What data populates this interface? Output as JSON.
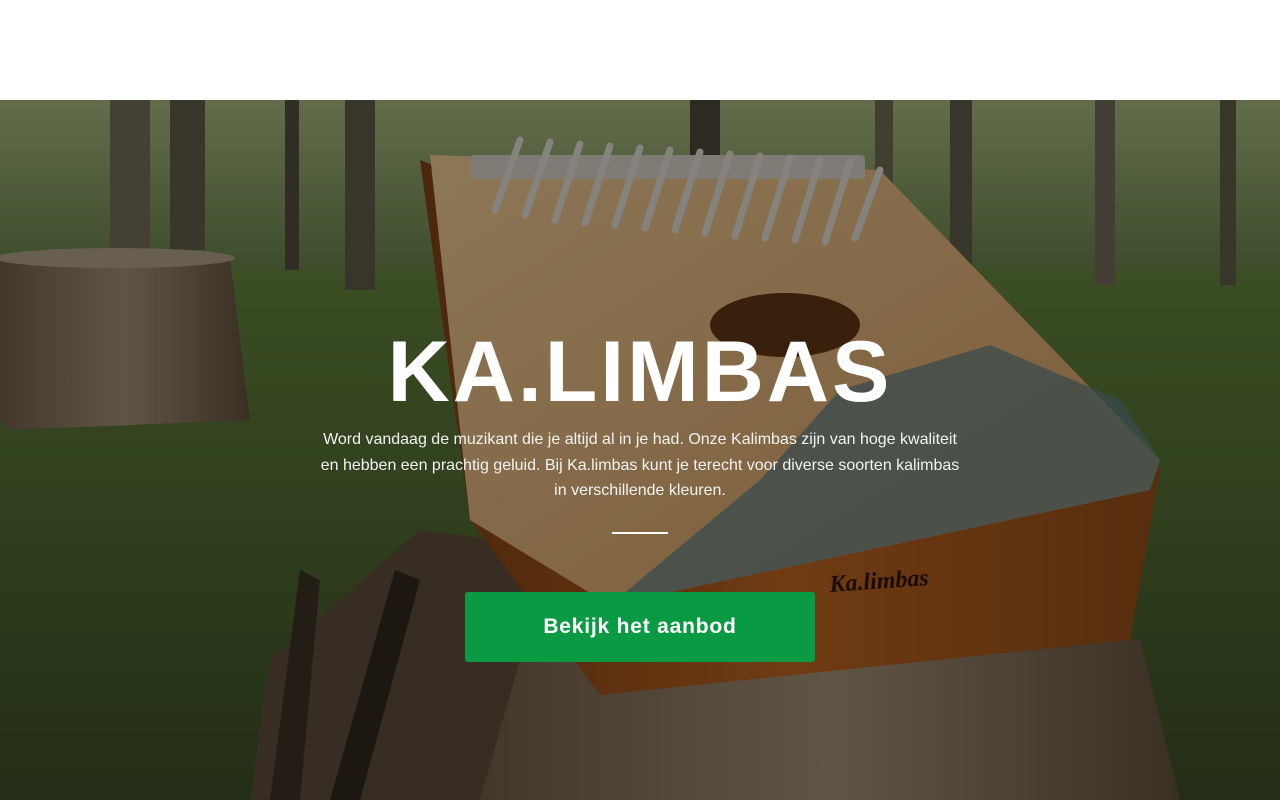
{
  "hero": {
    "title": "KA.LIMBAS",
    "description": "Word vandaag de muzikant die je altijd al in je had. Onze Kalimbas zijn van hoge kwaliteit en hebben een prachtig geluid. Bij Ka.limbas kunt je terecht voor diverse soorten kalimbas in verschillende kleuren.",
    "cta_label": "Bekijk het aanbod",
    "instrument_brand": "Ka.limbas"
  },
  "colors": {
    "cta_background": "#0b9a44",
    "overlay": "rgba(0,0,0,0.38)",
    "text": "#ffffff"
  }
}
